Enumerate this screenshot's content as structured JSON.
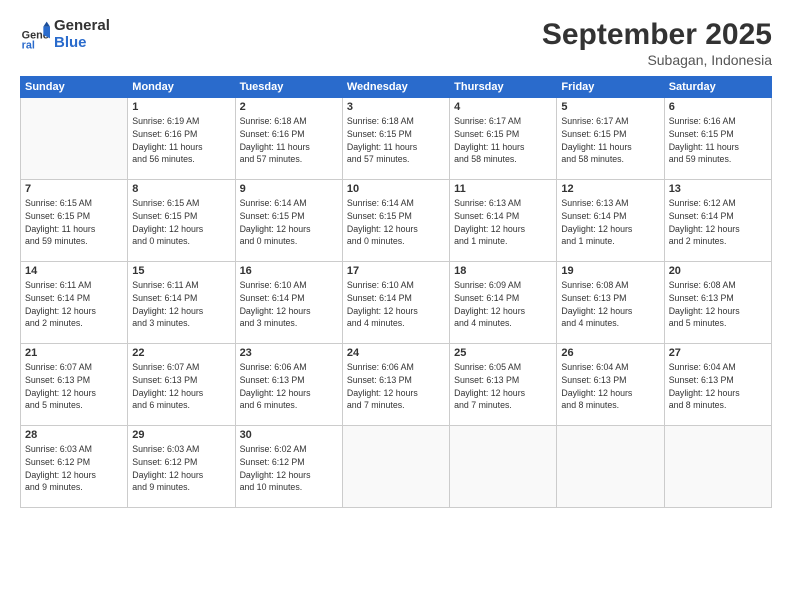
{
  "header": {
    "logo_general": "General",
    "logo_blue": "Blue",
    "month_title": "September 2025",
    "subtitle": "Subagan, Indonesia"
  },
  "days_of_week": [
    "Sunday",
    "Monday",
    "Tuesday",
    "Wednesday",
    "Thursday",
    "Friday",
    "Saturday"
  ],
  "weeks": [
    [
      {
        "day": "",
        "info": ""
      },
      {
        "day": "1",
        "info": "Sunrise: 6:19 AM\nSunset: 6:16 PM\nDaylight: 11 hours\nand 56 minutes."
      },
      {
        "day": "2",
        "info": "Sunrise: 6:18 AM\nSunset: 6:16 PM\nDaylight: 11 hours\nand 57 minutes."
      },
      {
        "day": "3",
        "info": "Sunrise: 6:18 AM\nSunset: 6:15 PM\nDaylight: 11 hours\nand 57 minutes."
      },
      {
        "day": "4",
        "info": "Sunrise: 6:17 AM\nSunset: 6:15 PM\nDaylight: 11 hours\nand 58 minutes."
      },
      {
        "day": "5",
        "info": "Sunrise: 6:17 AM\nSunset: 6:15 PM\nDaylight: 11 hours\nand 58 minutes."
      },
      {
        "day": "6",
        "info": "Sunrise: 6:16 AM\nSunset: 6:15 PM\nDaylight: 11 hours\nand 59 minutes."
      }
    ],
    [
      {
        "day": "7",
        "info": "Sunrise: 6:15 AM\nSunset: 6:15 PM\nDaylight: 11 hours\nand 59 minutes."
      },
      {
        "day": "8",
        "info": "Sunrise: 6:15 AM\nSunset: 6:15 PM\nDaylight: 12 hours\nand 0 minutes."
      },
      {
        "day": "9",
        "info": "Sunrise: 6:14 AM\nSunset: 6:15 PM\nDaylight: 12 hours\nand 0 minutes."
      },
      {
        "day": "10",
        "info": "Sunrise: 6:14 AM\nSunset: 6:15 PM\nDaylight: 12 hours\nand 0 minutes."
      },
      {
        "day": "11",
        "info": "Sunrise: 6:13 AM\nSunset: 6:14 PM\nDaylight: 12 hours\nand 1 minute."
      },
      {
        "day": "12",
        "info": "Sunrise: 6:13 AM\nSunset: 6:14 PM\nDaylight: 12 hours\nand 1 minute."
      },
      {
        "day": "13",
        "info": "Sunrise: 6:12 AM\nSunset: 6:14 PM\nDaylight: 12 hours\nand 2 minutes."
      }
    ],
    [
      {
        "day": "14",
        "info": "Sunrise: 6:11 AM\nSunset: 6:14 PM\nDaylight: 12 hours\nand 2 minutes."
      },
      {
        "day": "15",
        "info": "Sunrise: 6:11 AM\nSunset: 6:14 PM\nDaylight: 12 hours\nand 3 minutes."
      },
      {
        "day": "16",
        "info": "Sunrise: 6:10 AM\nSunset: 6:14 PM\nDaylight: 12 hours\nand 3 minutes."
      },
      {
        "day": "17",
        "info": "Sunrise: 6:10 AM\nSunset: 6:14 PM\nDaylight: 12 hours\nand 4 minutes."
      },
      {
        "day": "18",
        "info": "Sunrise: 6:09 AM\nSunset: 6:14 PM\nDaylight: 12 hours\nand 4 minutes."
      },
      {
        "day": "19",
        "info": "Sunrise: 6:08 AM\nSunset: 6:13 PM\nDaylight: 12 hours\nand 4 minutes."
      },
      {
        "day": "20",
        "info": "Sunrise: 6:08 AM\nSunset: 6:13 PM\nDaylight: 12 hours\nand 5 minutes."
      }
    ],
    [
      {
        "day": "21",
        "info": "Sunrise: 6:07 AM\nSunset: 6:13 PM\nDaylight: 12 hours\nand 5 minutes."
      },
      {
        "day": "22",
        "info": "Sunrise: 6:07 AM\nSunset: 6:13 PM\nDaylight: 12 hours\nand 6 minutes."
      },
      {
        "day": "23",
        "info": "Sunrise: 6:06 AM\nSunset: 6:13 PM\nDaylight: 12 hours\nand 6 minutes."
      },
      {
        "day": "24",
        "info": "Sunrise: 6:06 AM\nSunset: 6:13 PM\nDaylight: 12 hours\nand 7 minutes."
      },
      {
        "day": "25",
        "info": "Sunrise: 6:05 AM\nSunset: 6:13 PM\nDaylight: 12 hours\nand 7 minutes."
      },
      {
        "day": "26",
        "info": "Sunrise: 6:04 AM\nSunset: 6:13 PM\nDaylight: 12 hours\nand 8 minutes."
      },
      {
        "day": "27",
        "info": "Sunrise: 6:04 AM\nSunset: 6:13 PM\nDaylight: 12 hours\nand 8 minutes."
      }
    ],
    [
      {
        "day": "28",
        "info": "Sunrise: 6:03 AM\nSunset: 6:12 PM\nDaylight: 12 hours\nand 9 minutes."
      },
      {
        "day": "29",
        "info": "Sunrise: 6:03 AM\nSunset: 6:12 PM\nDaylight: 12 hours\nand 9 minutes."
      },
      {
        "day": "30",
        "info": "Sunrise: 6:02 AM\nSunset: 6:12 PM\nDaylight: 12 hours\nand 10 minutes."
      },
      {
        "day": "",
        "info": ""
      },
      {
        "day": "",
        "info": ""
      },
      {
        "day": "",
        "info": ""
      },
      {
        "day": "",
        "info": ""
      }
    ]
  ]
}
